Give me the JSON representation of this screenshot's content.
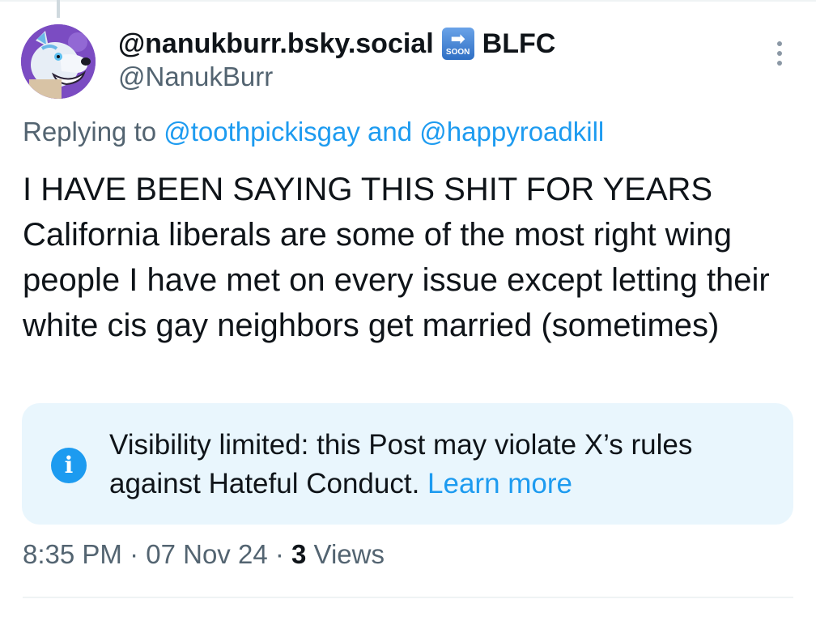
{
  "author": {
    "display_name": "@nanukburr.bsky.social",
    "emoji_icon": "soon-arrow-emoji",
    "emoji_text": "SOON",
    "name_suffix": "BLFC",
    "handle": "@NanukBurr"
  },
  "reply": {
    "prefix": "Replying to ",
    "user1": "@toothpickisgay",
    "joiner": " and ",
    "user2": "@happyroadkill"
  },
  "post": {
    "text": "I HAVE BEEN SAYING THIS SHIT FOR YEARS\nCalifornia liberals are some of the most right wing people I have met on every issue except letting their white cis gay neighbors get married (sometimes)"
  },
  "notice": {
    "text": "Visibility limited: this Post may violate X’s rules against Hateful Conduct. ",
    "link": "Learn more"
  },
  "meta": {
    "time": "8:35 PM",
    "sep": " · ",
    "date": "07 Nov 24",
    "views_count": "3",
    "views_label": " Views"
  },
  "colors": {
    "link": "#1d9bf0",
    "secondary_text": "#536471",
    "notice_bg": "#e9f6fd"
  }
}
